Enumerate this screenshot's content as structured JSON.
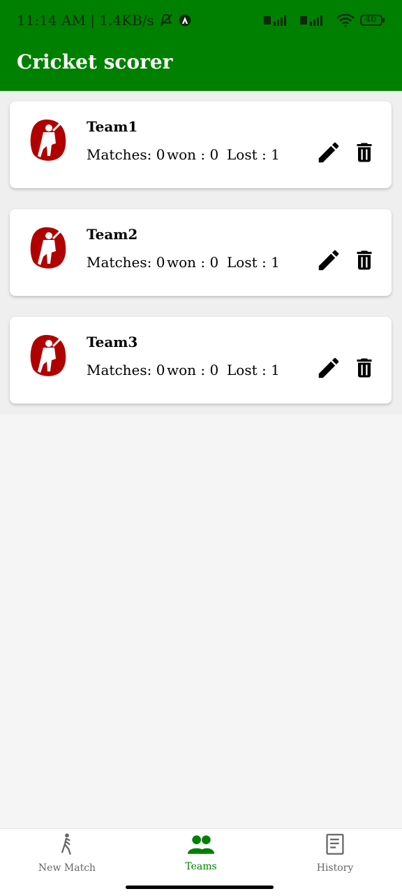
{
  "status_bar": {
    "time_speed": "11:14 AM | 1.4KB/s",
    "battery": "46"
  },
  "app": {
    "title": "Cricket scorer"
  },
  "teams": [
    {
      "name": "Team1",
      "matches_label": "Matches: 0",
      "won_label": "won : 0",
      "lost_label": "Lost : 1"
    },
    {
      "name": "Team2",
      "matches_label": "Matches: 0",
      "won_label": "won : 0",
      "lost_label": "Lost : 1"
    },
    {
      "name": "Team3",
      "matches_label": "Matches: 0",
      "won_label": "won : 0",
      "lost_label": "Lost : 1"
    }
  ],
  "nav": [
    {
      "label": "New Match",
      "icon": "walk-icon"
    },
    {
      "label": "Teams",
      "icon": "people-icon",
      "active": true
    },
    {
      "label": "History",
      "icon": "document-icon"
    }
  ],
  "colors": {
    "brand": "#008000",
    "logo_red": "#b00000"
  }
}
